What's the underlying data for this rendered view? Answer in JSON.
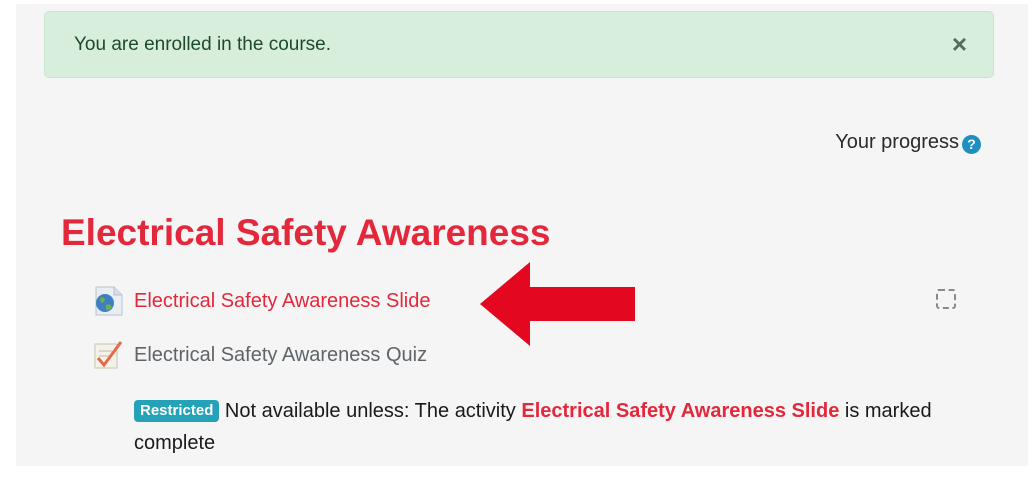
{
  "alert": {
    "message": "You are enrolled in the course.",
    "close_glyph": "×"
  },
  "progress": {
    "label": "Your progress",
    "help_glyph": "?"
  },
  "section": {
    "title": "Electrical Safety Awareness"
  },
  "activities": [
    {
      "label": "Electrical Safety Awareness Slide",
      "icon": "url-resource-icon"
    },
    {
      "label": "Electrical Safety Awareness Quiz",
      "icon": "quiz-icon"
    }
  ],
  "restriction": {
    "badge": "Restricted",
    "prefix": "Not available unless: The activity",
    "activity_link": "Electrical Safety Awareness Slide",
    "suffix": "is marked complete"
  },
  "colors": {
    "accent": "#e3283c",
    "alert_bg": "#d8eedd",
    "badge": "#23a2b8",
    "annotation_arrow": "#e3081f"
  }
}
